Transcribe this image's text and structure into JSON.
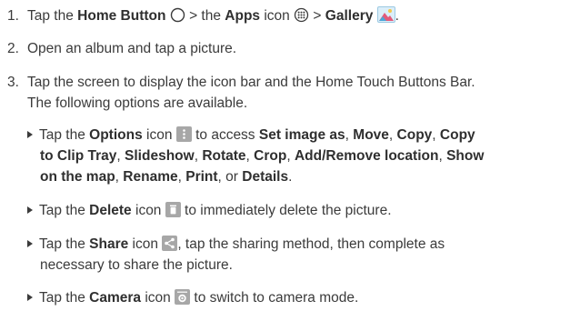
{
  "steps": [
    {
      "num": "1.",
      "t1": "Tap the ",
      "b1": "Home Button",
      "t2": " > the ",
      "b2": "Apps",
      "t3": " icon ",
      "t4": " > ",
      "b3": "Gallery",
      "t5": "."
    },
    {
      "num": "2.",
      "t1": "Open an album and tap a picture."
    },
    {
      "num": "3.",
      "t1": "Tap the screen to display the icon bar and the Home Touch Buttons Bar.",
      "t2": "The following options are available."
    }
  ],
  "bullets": {
    "options": {
      "t1": "Tap the ",
      "b1": "Options",
      "t2": " icon ",
      "t3": " to access ",
      "b2": "Set image as",
      "t4": ", ",
      "b3": "Move",
      "t5": ", ",
      "b4": "Copy",
      "t6": ", ",
      "b5": "Copy",
      "b6": "to Clip Tray",
      "t7": ", ",
      "b7": "Slideshow",
      "t8": ", ",
      "b8": "Rotate",
      "t9": ", ",
      "b9": "Crop",
      "t10": ", ",
      "b10": "Add/Remove location",
      "t11": ", ",
      "b11": "Show",
      "b12": "on the map",
      "t12": ", ",
      "b13": "Rename",
      "t13": ", ",
      "b14": "Print",
      "t14": ", or ",
      "b15": "Details",
      "t15": "."
    },
    "delete": {
      "t1": "Tap the ",
      "b1": "Delete",
      "t2": " icon ",
      "t3": " to immediately delete the picture."
    },
    "share": {
      "t1": "Tap the ",
      "b1": "Share",
      "t2": " icon ",
      "t3": ", tap the sharing method, then complete as",
      "t4": "necessary to share the picture."
    },
    "camera": {
      "t1": "Tap the ",
      "b1": "Camera",
      "t2": " icon ",
      "t3": " to switch to camera mode."
    }
  },
  "icons": {
    "home": "home-button-icon",
    "apps": "apps-icon",
    "gallery": "gallery-icon",
    "options": "options-icon",
    "delete": "delete-icon",
    "share": "share-icon",
    "camera": "camera-icon"
  },
  "colors": {
    "text": "#3b3b3b",
    "icon_gray": "#a7a7a7",
    "icon_blue": "#4aa6d8",
    "gallery_pink": "#e35a7a"
  }
}
